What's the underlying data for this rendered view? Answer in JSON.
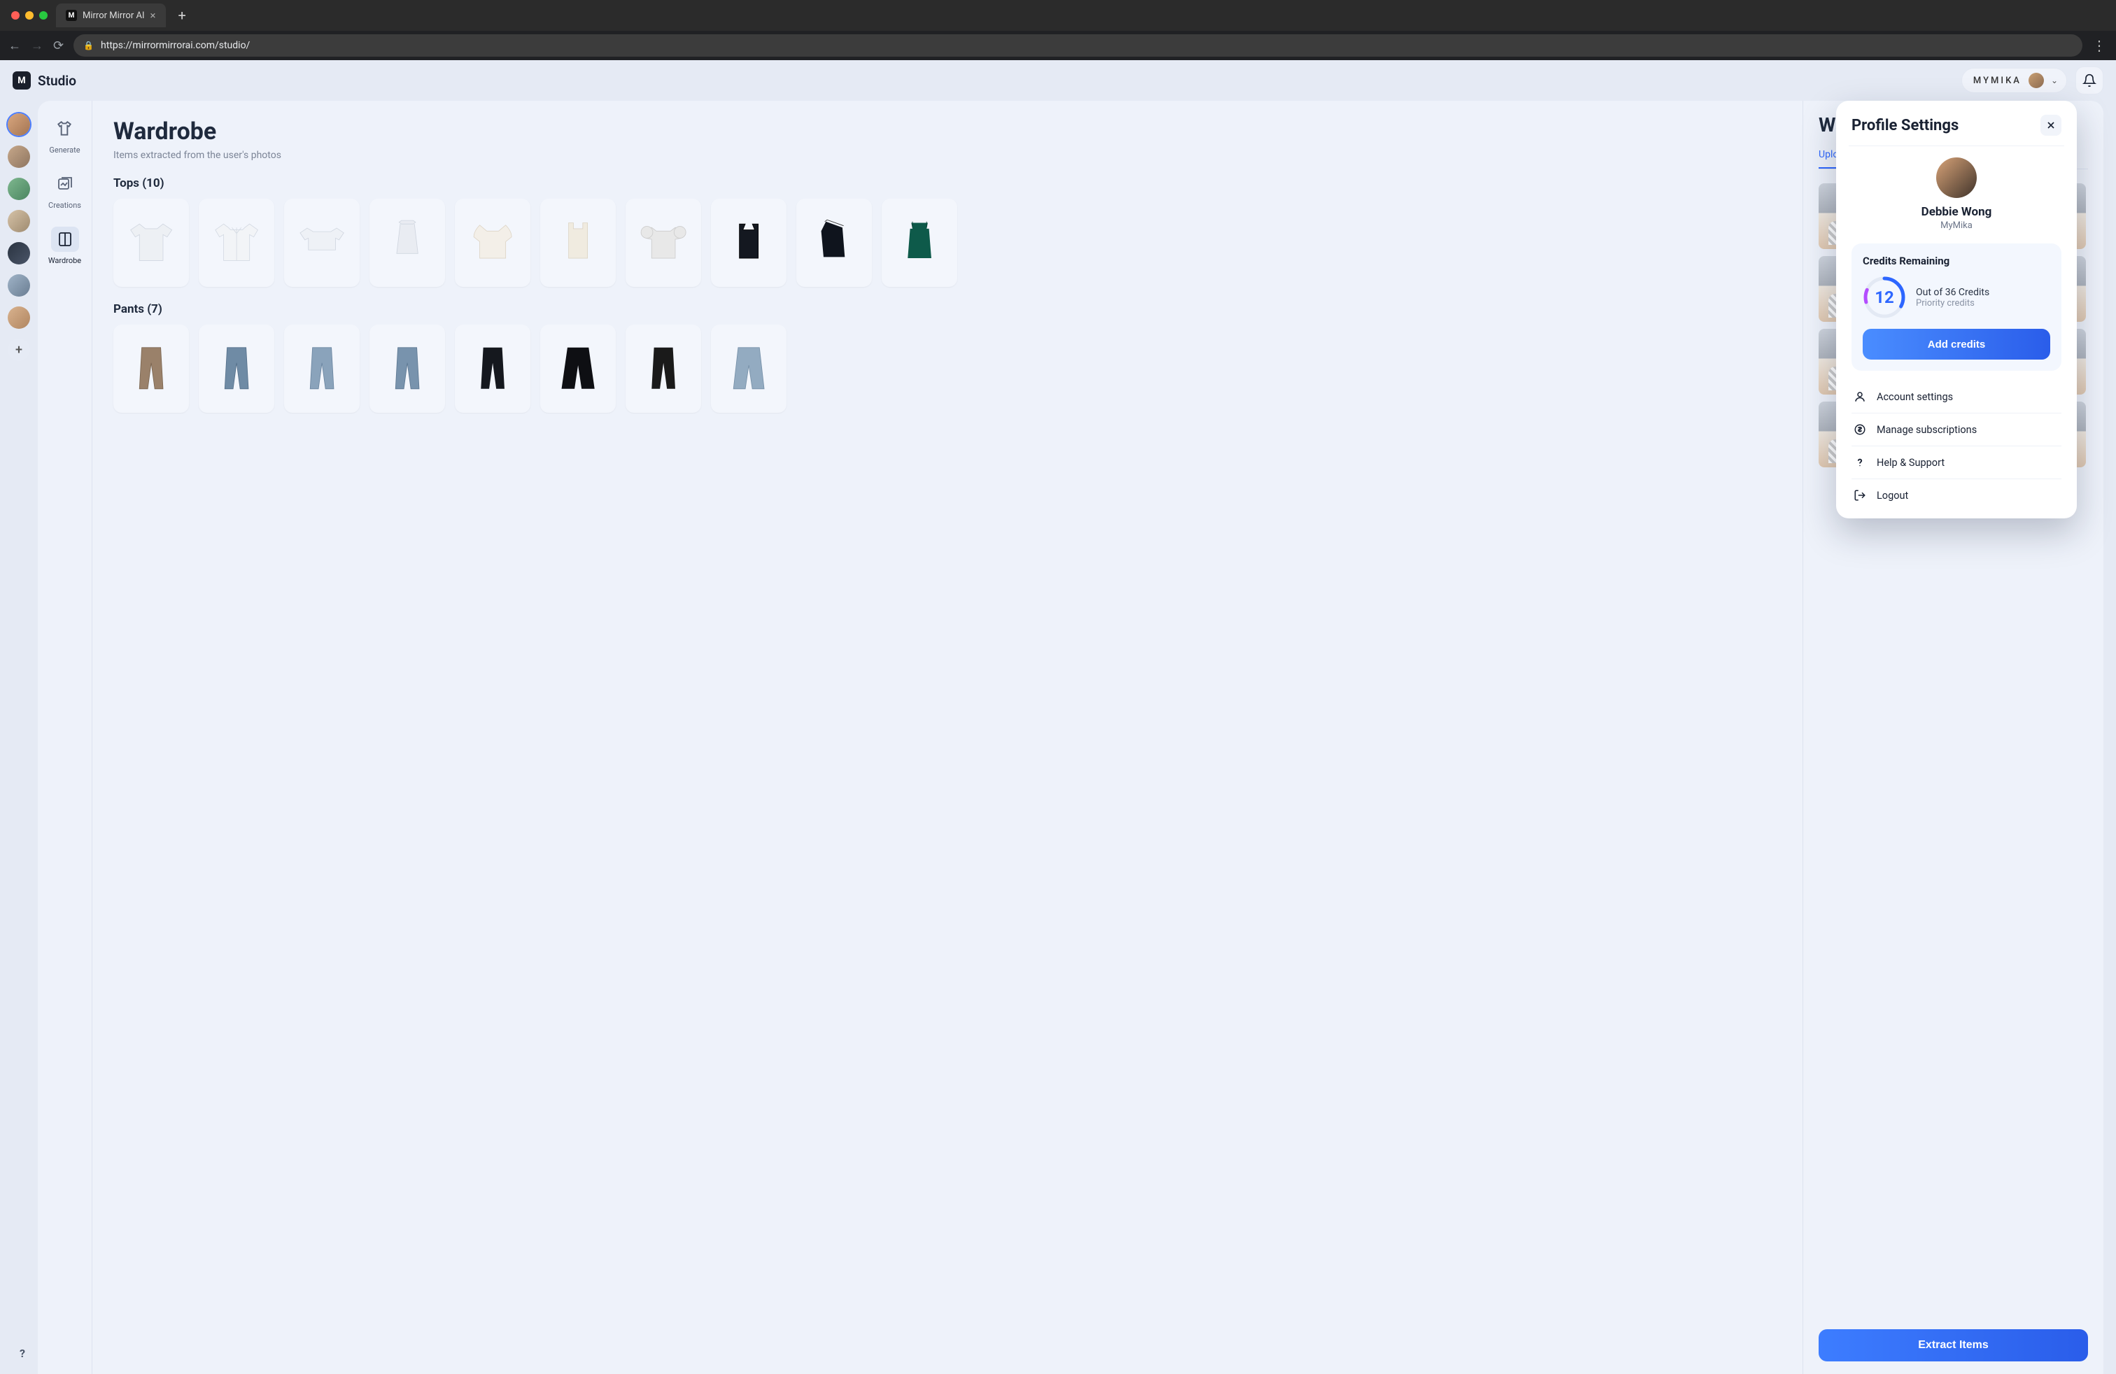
{
  "browser": {
    "tab_title": "Mirror Mirror AI",
    "url": "https://mirrormirrorai.com/studio/"
  },
  "header": {
    "app_name": "Studio",
    "account_badge": "MYMIKA"
  },
  "side_nav": {
    "generate": "Generate",
    "creations": "Creations",
    "wardrobe": "Wardrobe"
  },
  "wardrobe": {
    "title": "Wardrobe",
    "subtitle": "Items extracted from the user's photos",
    "tops_label": "Tops (10)",
    "pants_label": "Pants (7)"
  },
  "right_panel": {
    "title": "Wardrobe",
    "tab_upload": "Upload",
    "extract_button": "Extract Items"
  },
  "popover": {
    "title": "Profile Settings",
    "user_name": "Debbie Wong",
    "user_role": "MyMika",
    "credits_title": "Credits Remaining",
    "credits_value": "12",
    "credits_line1": "Out of 36 Credits",
    "credits_line2": "Priority credits",
    "add_credits": "Add credits",
    "menu": {
      "account": "Account settings",
      "subs": "Manage subscriptions",
      "help": "Help & Support",
      "logout": "Logout"
    }
  },
  "help_glyph": "?"
}
